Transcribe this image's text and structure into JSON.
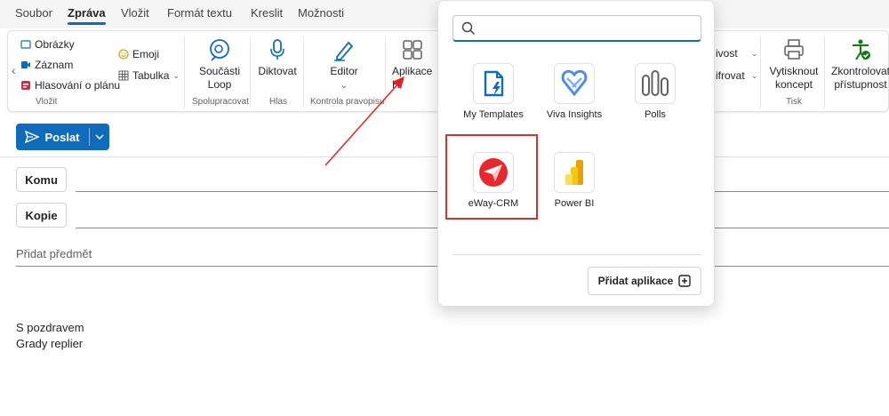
{
  "tabs": [
    "Soubor",
    "Zpráva",
    "Vložit",
    "Formát textu",
    "Kreslit",
    "Možnosti"
  ],
  "active_tab": "Zpráva",
  "ribbon": {
    "insert": {
      "images": "Obrázky",
      "record": "Záznam",
      "poll": "Hlasování o plánu",
      "emoji": "Emoji",
      "table": "Tabulka",
      "group": "Vložit"
    },
    "loop": {
      "label1": "Součásti",
      "label2": "Loop",
      "group": "Spolupracovat"
    },
    "dictate": {
      "label": "Diktovat",
      "group": "Hlas"
    },
    "editor": {
      "label": "Editor",
      "group": "Kontrola pravopisu"
    },
    "apps": {
      "label": "Aplikace H"
    },
    "hidden1": "ivost",
    "hidden2": "ifrovat",
    "print": {
      "label1": "Vytisknout",
      "label2": "koncept",
      "group": "Tisk"
    },
    "accessibility": {
      "label1": "Zkontrolovat",
      "label2": "přístupnost"
    }
  },
  "compose": {
    "send": "Poslat",
    "to": "Komu",
    "cc": "Kopie",
    "subject_placeholder": "Přidat předmět",
    "signature_line1": "S pozdravem",
    "signature_line2": "Grady replier"
  },
  "apps_popover": {
    "search_placeholder": "",
    "apps": [
      {
        "name": "My Templates",
        "icon": "my-templates-icon"
      },
      {
        "name": "Viva Insights",
        "icon": "viva-insights-icon"
      },
      {
        "name": "Polls",
        "icon": "polls-icon"
      },
      {
        "name": "eWay-CRM",
        "icon": "eway-crm-icon"
      },
      {
        "name": "Power BI",
        "icon": "power-bi-icon"
      }
    ],
    "add_apps": "Přidat aplikace"
  },
  "colors": {
    "accent": "#0f6cbd",
    "highlight": "#d63030",
    "arrow": "#e02424"
  }
}
